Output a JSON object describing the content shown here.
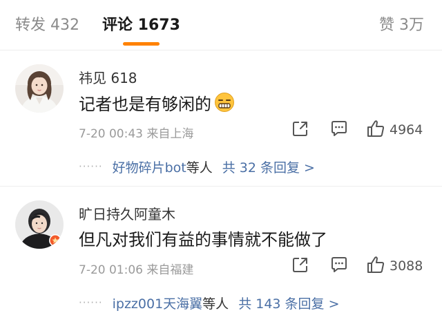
{
  "tabs": {
    "repost": "转发 432",
    "comment": "评论 1673",
    "like": "赞 3万"
  },
  "colors": {
    "accent": "#ff8200",
    "link": "#4a6fa5"
  },
  "comments": [
    {
      "username": "祎见 618",
      "text": "记者也是有够闲的",
      "emoji": "grimace-face-emoji",
      "meta": "7-20 00:43 来自上海",
      "likes": "4964",
      "ellipsis": "······",
      "repliers": "好物碎片bot",
      "and_others": "等人",
      "reply_count": "共 32 条回复 >"
    },
    {
      "username": "旷日持久阿童木",
      "text": "但凡对我们有益的事情就不能做了",
      "meta": "7-20 01:06 来自福建",
      "likes": "3088",
      "ellipsis": "······",
      "repliers": "ipzz001天海翼",
      "and_others": "等人",
      "reply_count": "共 143 条回复 >"
    }
  ]
}
